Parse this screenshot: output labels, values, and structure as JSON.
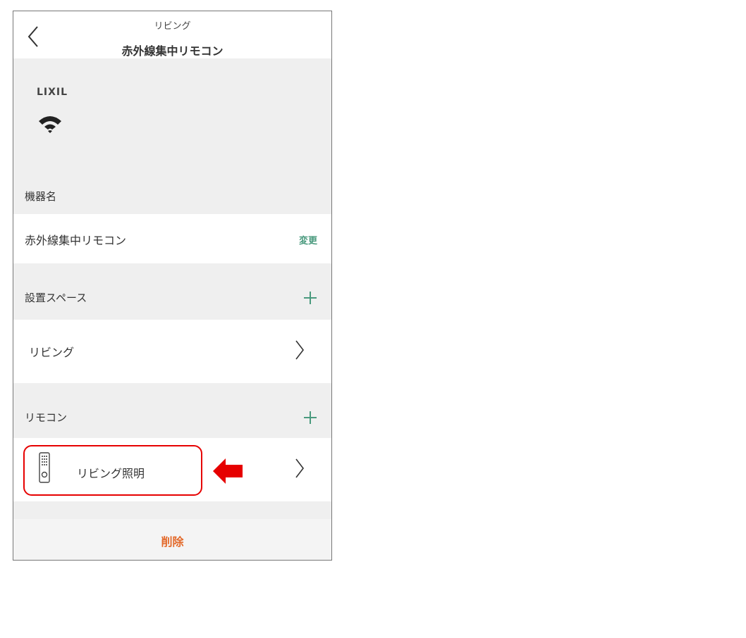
{
  "navbar": {
    "subtitle": "リビング",
    "title": "赤外線集中リモコン"
  },
  "device": {
    "brand": "LIXIL"
  },
  "device_name_section": {
    "label": "機器名",
    "value": "赤外線集中リモコン",
    "change_label": "変更"
  },
  "space_section": {
    "label": "設置スペース",
    "item": "リビング"
  },
  "remote_section": {
    "label": "リモコン",
    "item": "リビング照明"
  },
  "footer": {
    "delete_label": "削除"
  },
  "colors": {
    "accent_green": "#4a9a7e",
    "delete_orange": "#e3692a",
    "highlight_red": "#e60000"
  }
}
